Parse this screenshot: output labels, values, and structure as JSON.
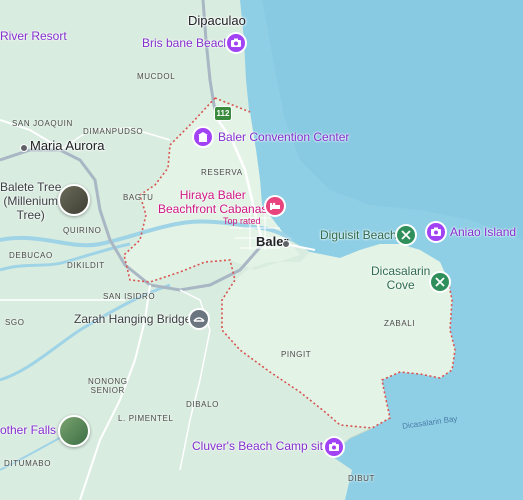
{
  "map": {
    "colors": {
      "land": "#d9ece0",
      "land_selected": "#e3f3e6",
      "sea": "#8fcfe6",
      "river": "#9fd3e6",
      "road": "#ffffff",
      "highway": "#a9b6c4",
      "boundary": "#d9534f",
      "poi_purple": "#8430ce",
      "poi_green": "#2e6b4f",
      "poi_red": "#d01884"
    },
    "route_badge": "112",
    "towns": {
      "dipaculao": "Dipaculao",
      "maria_aurora": "Maria Aurora",
      "baler": "Baler"
    },
    "barangays": {
      "san_joaquin": "SAN JOAQUIN",
      "mucdol": "MUCDOL",
      "dimanpudso": "DIMANPUDSO",
      "reserva": "RESERVA",
      "bagtu": "BAGTU",
      "quirino": "QUIRINO",
      "debucao": "DEBUCAO",
      "dikildit": "DIKILDIT",
      "san_isidro": "SAN ISIDRO",
      "zabali": "ZABALI",
      "pingit": "PINGIT",
      "nonong_senior": "NONONG\nSENIOR",
      "dibalo": "DIBALO",
      "l_pimentel": "L. PIMENTEL",
      "ditumabo": "DITUMABO",
      "dibut": "DIBUT",
      "sgo": "SGO"
    },
    "water_labels": {
      "dicasalarin_bay": "Dicasalarin Bay"
    },
    "places": {
      "river_resort": "River Resort",
      "brisbane_beach": "Bris bane Beach",
      "baler_convention_center": "Baler Convention Center",
      "balete_tree": "Balete Tree\n(Millenium\nTree)",
      "hiraya_baler": "Hiraya Baler\nBeachfront Cabanas",
      "hiraya_sub": "Top rated",
      "diguisit_beach": "Diguisit Beach",
      "aniao_island": "Aniao Island",
      "dicasalarin_cove": "Dicasalarin\nCove",
      "zarah_bridge": "Zarah Hanging Bridge",
      "mother_falls": "other Falls",
      "cluvers_beach": "Cluver's Beach Camp site"
    }
  }
}
